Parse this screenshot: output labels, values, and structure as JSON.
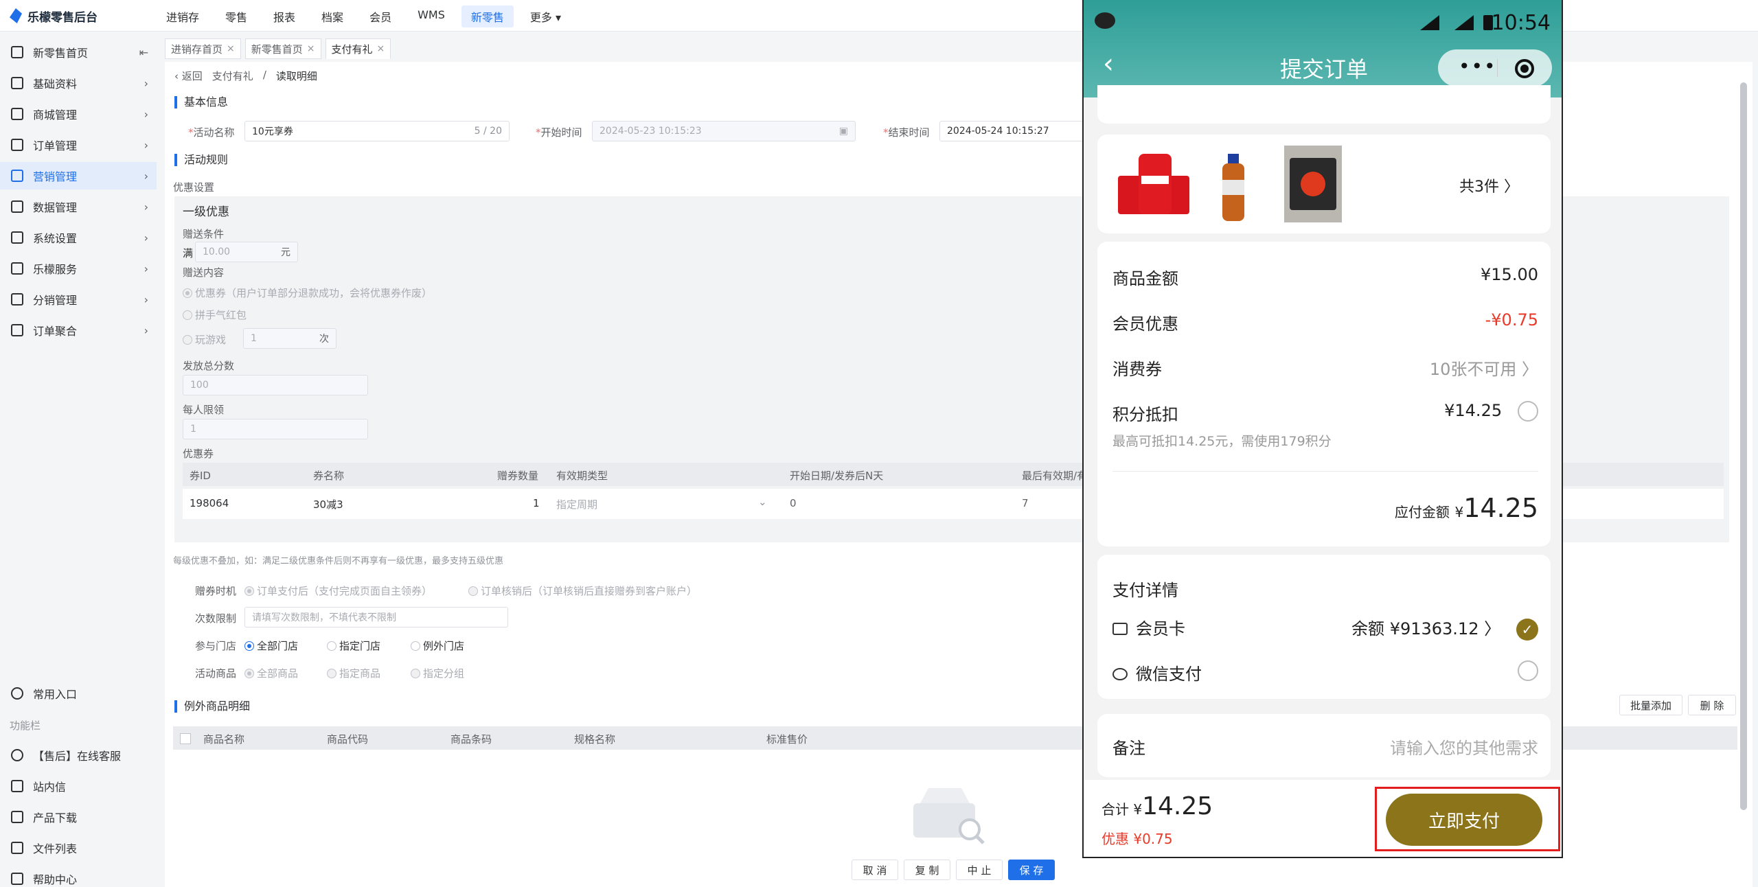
{
  "app": {
    "title": "乐檬零售后台"
  },
  "topnav": [
    "进销存",
    "零售",
    "报表",
    "档案",
    "会员",
    "WMS",
    "新零售",
    "更多"
  ],
  "topnav_active_index": 6,
  "sidebar": {
    "items": [
      {
        "label": "新零售首页",
        "icon": "home-icon"
      },
      {
        "label": "基础资料",
        "icon": "grid-icon"
      },
      {
        "label": "商城管理",
        "icon": "store-icon"
      },
      {
        "label": "订单管理",
        "icon": "order-icon"
      },
      {
        "label": "营销管理",
        "icon": "marketing-icon",
        "active": true
      },
      {
        "label": "数据管理",
        "icon": "chart-icon"
      },
      {
        "label": "系统设置",
        "icon": "gear-icon"
      },
      {
        "label": "乐檬服务",
        "icon": "service-icon"
      },
      {
        "label": "分销管理",
        "icon": "distribution-icon"
      },
      {
        "label": "订单聚合",
        "icon": "aggregate-icon"
      }
    ],
    "common": "常用入口",
    "section": "功能栏",
    "bottom": [
      "【售后】在线客服",
      "站内信",
      "产品下载",
      "文件列表",
      "帮助中心"
    ]
  },
  "tabs": [
    "进销存首页",
    "新零售首页",
    "支付有礼"
  ],
  "crumb": {
    "back": "返回",
    "parent": "支付有礼",
    "sep": "/",
    "current": "读取明细"
  },
  "basic": {
    "title": "基本信息",
    "name_label": "活动名称",
    "name_value": "10元享券",
    "name_count": "5 / 20",
    "start_label": "开始时间",
    "start_value": "2024-05-23 10:15:23",
    "end_label": "结束时间",
    "end_value": "2024-05-24 10:15:27"
  },
  "rules": {
    "title": "活动规则",
    "setting": "优惠设置",
    "level": "一级优惠",
    "cond_label": "赠送条件",
    "cond_prefix": "满",
    "cond_value": "10.00",
    "cond_unit": "元",
    "content_label": "赠送内容",
    "opt_coupon": "优惠券（用户订单部分退款成功，会将优惠券作废）",
    "opt_redpack": "拼手气红包",
    "opt_game": "玩游戏",
    "game_value": "1",
    "game_unit": "次",
    "total_label": "发放总分数",
    "total_value": "100",
    "limit_label": "每人限领",
    "limit_value": "1",
    "coupon_label": "优惠券",
    "table_headers": [
      "券ID",
      "券名称",
      "赠券数量",
      "有效期类型",
      "开始日期/发券后N天",
      "最后有效期/有"
    ],
    "table_row": [
      "198064",
      "30减3",
      "1",
      "指定周期",
      "0",
      "7"
    ],
    "note": "每级优惠不叠加，如：满足二级优惠条件后则不再享有一级优惠，最多支持五级优惠"
  },
  "extra": {
    "timing_label": "赠券时机",
    "timing_opt1": "订单支付后（支付完成页面自主领券）",
    "timing_opt2": "订单核销后（订单核销后直接赠券到客户账户）",
    "times_label": "次数限制",
    "times_placeholder": "请填写次数限制，不填代表不限制",
    "store_label": "参与门店",
    "store_opts": [
      "全部门店",
      "指定门店",
      "例外门店"
    ],
    "goods_label": "活动商品",
    "goods_opts": [
      "全部商品",
      "指定商品",
      "指定分组"
    ]
  },
  "exceptions": {
    "title": "例外商品明细",
    "batch_add": "批量添加",
    "delete": "删 除",
    "headers": [
      "商品名称",
      "商品代码",
      "商品条码",
      "规格名称",
      "标准售价"
    ]
  },
  "footer": {
    "cancel": "取 消",
    "copy": "复 制",
    "stop": "中 止",
    "save": "保 存"
  },
  "phone": {
    "time": "10:54",
    "title": "提交订单",
    "products_count": "共3件 〉",
    "goods_amount_label": "商品金额",
    "goods_amount": "¥15.00",
    "member_discount_label": "会员优惠",
    "member_discount": "-¥0.75",
    "voucher_label": "消费券",
    "voucher_value": "10张不可用 〉",
    "points_label": "积分抵扣",
    "points_value": "¥14.25",
    "points_note": "最高可抵扣14.25元，需使用179积分",
    "payable_label": "应付金额",
    "payable_currency": "¥",
    "payable_value": "14.25",
    "pay_detail": "支付详情",
    "card_label": "会员卡",
    "card_balance": "余额 ¥91363.12 〉",
    "wechat_label": "微信支付",
    "remark_label": "备注",
    "remark_placeholder": "请输入您的其他需求",
    "total_label": "合计",
    "total_currency": "¥",
    "total_value": "14.25",
    "discount_label": "优惠 ¥0.75",
    "pay_button": "立即支付"
  },
  "colors": {
    "accent": "#1e6fe8",
    "gold": "#8b7419",
    "teal": "#2e9e97",
    "red": "#e31c1c"
  }
}
